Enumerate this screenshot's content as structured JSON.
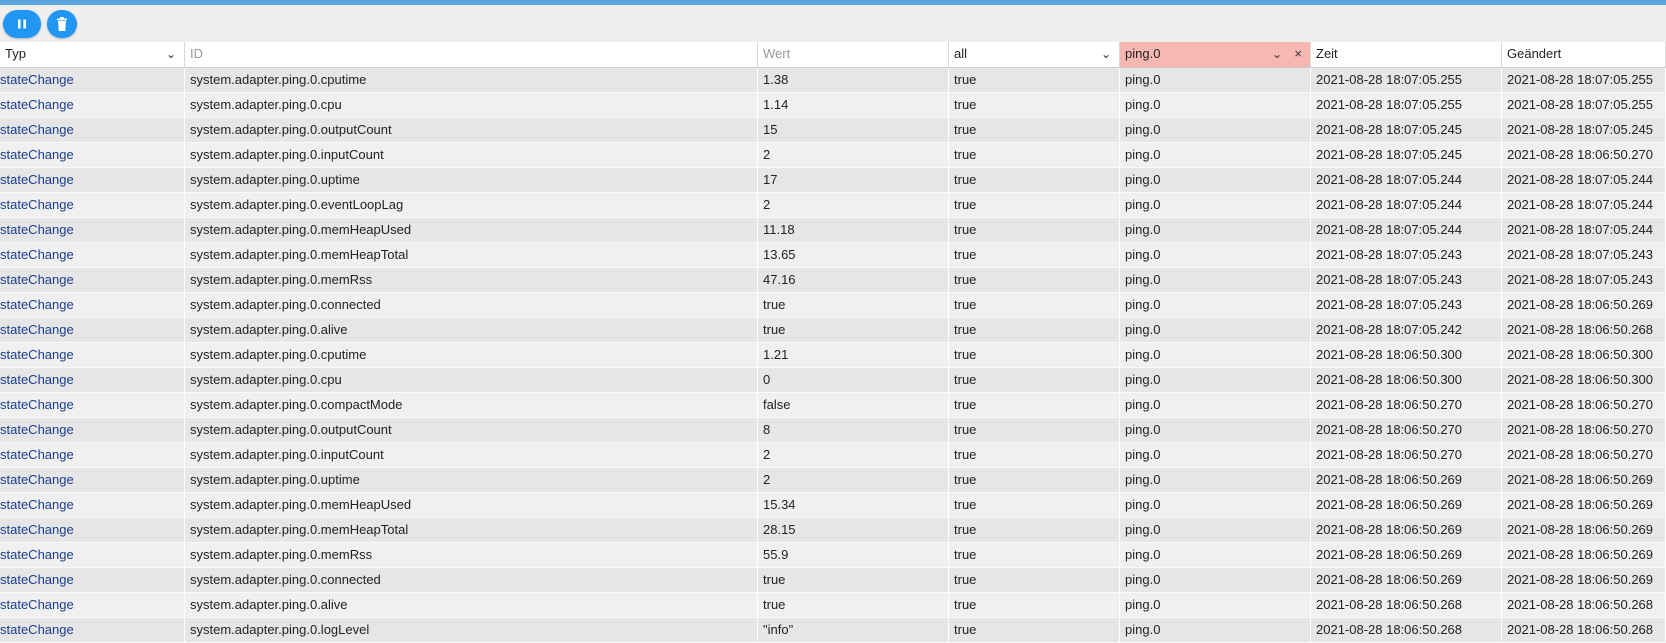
{
  "toolbar": {
    "pause_icon": "pause-icon",
    "delete_icon": "trash-icon",
    "accent": "#2196f3"
  },
  "filters": {
    "type": {
      "value": "Typ"
    },
    "id": {
      "placeholder": "ID"
    },
    "value": {
      "placeholder": "Wert"
    },
    "ack": {
      "value": "all"
    },
    "from": {
      "value": "ping.0",
      "clear": "×"
    },
    "time_label": "Zeit",
    "changed_label": "Geändert"
  },
  "rows": [
    {
      "type": "stateChange",
      "id": "system.adapter.ping.0.cputime",
      "value": "1.38",
      "ack": "true",
      "from": "ping.0",
      "time": "2021-08-28 18:07:05.255",
      "changed": "2021-08-28 18:07:05.255"
    },
    {
      "type": "stateChange",
      "id": "system.adapter.ping.0.cpu",
      "value": "1.14",
      "ack": "true",
      "from": "ping.0",
      "time": "2021-08-28 18:07:05.255",
      "changed": "2021-08-28 18:07:05.255"
    },
    {
      "type": "stateChange",
      "id": "system.adapter.ping.0.outputCount",
      "value": "15",
      "ack": "true",
      "from": "ping.0",
      "time": "2021-08-28 18:07:05.245",
      "changed": "2021-08-28 18:07:05.245"
    },
    {
      "type": "stateChange",
      "id": "system.adapter.ping.0.inputCount",
      "value": "2",
      "ack": "true",
      "from": "ping.0",
      "time": "2021-08-28 18:07:05.245",
      "changed": "2021-08-28 18:06:50.270"
    },
    {
      "type": "stateChange",
      "id": "system.adapter.ping.0.uptime",
      "value": "17",
      "ack": "true",
      "from": "ping.0",
      "time": "2021-08-28 18:07:05.244",
      "changed": "2021-08-28 18:07:05.244"
    },
    {
      "type": "stateChange",
      "id": "system.adapter.ping.0.eventLoopLag",
      "value": "2",
      "ack": "true",
      "from": "ping.0",
      "time": "2021-08-28 18:07:05.244",
      "changed": "2021-08-28 18:07:05.244"
    },
    {
      "type": "stateChange",
      "id": "system.adapter.ping.0.memHeapUsed",
      "value": "11.18",
      "ack": "true",
      "from": "ping.0",
      "time": "2021-08-28 18:07:05.244",
      "changed": "2021-08-28 18:07:05.244"
    },
    {
      "type": "stateChange",
      "id": "system.adapter.ping.0.memHeapTotal",
      "value": "13.65",
      "ack": "true",
      "from": "ping.0",
      "time": "2021-08-28 18:07:05.243",
      "changed": "2021-08-28 18:07:05.243"
    },
    {
      "type": "stateChange",
      "id": "system.adapter.ping.0.memRss",
      "value": "47.16",
      "ack": "true",
      "from": "ping.0",
      "time": "2021-08-28 18:07:05.243",
      "changed": "2021-08-28 18:07:05.243"
    },
    {
      "type": "stateChange",
      "id": "system.adapter.ping.0.connected",
      "value": "true",
      "ack": "true",
      "from": "ping.0",
      "time": "2021-08-28 18:07:05.243",
      "changed": "2021-08-28 18:06:50.269"
    },
    {
      "type": "stateChange",
      "id": "system.adapter.ping.0.alive",
      "value": "true",
      "ack": "true",
      "from": "ping.0",
      "time": "2021-08-28 18:07:05.242",
      "changed": "2021-08-28 18:06:50.268"
    },
    {
      "type": "stateChange",
      "id": "system.adapter.ping.0.cputime",
      "value": "1.21",
      "ack": "true",
      "from": "ping.0",
      "time": "2021-08-28 18:06:50.300",
      "changed": "2021-08-28 18:06:50.300"
    },
    {
      "type": "stateChange",
      "id": "system.adapter.ping.0.cpu",
      "value": "0",
      "ack": "true",
      "from": "ping.0",
      "time": "2021-08-28 18:06:50.300",
      "changed": "2021-08-28 18:06:50.300"
    },
    {
      "type": "stateChange",
      "id": "system.adapter.ping.0.compactMode",
      "value": "false",
      "ack": "true",
      "from": "ping.0",
      "time": "2021-08-28 18:06:50.270",
      "changed": "2021-08-28 18:06:50.270"
    },
    {
      "type": "stateChange",
      "id": "system.adapter.ping.0.outputCount",
      "value": "8",
      "ack": "true",
      "from": "ping.0",
      "time": "2021-08-28 18:06:50.270",
      "changed": "2021-08-28 18:06:50.270"
    },
    {
      "type": "stateChange",
      "id": "system.adapter.ping.0.inputCount",
      "value": "2",
      "ack": "true",
      "from": "ping.0",
      "time": "2021-08-28 18:06:50.270",
      "changed": "2021-08-28 18:06:50.270"
    },
    {
      "type": "stateChange",
      "id": "system.adapter.ping.0.uptime",
      "value": "2",
      "ack": "true",
      "from": "ping.0",
      "time": "2021-08-28 18:06:50.269",
      "changed": "2021-08-28 18:06:50.269"
    },
    {
      "type": "stateChange",
      "id": "system.adapter.ping.0.memHeapUsed",
      "value": "15.34",
      "ack": "true",
      "from": "ping.0",
      "time": "2021-08-28 18:06:50.269",
      "changed": "2021-08-28 18:06:50.269"
    },
    {
      "type": "stateChange",
      "id": "system.adapter.ping.0.memHeapTotal",
      "value": "28.15",
      "ack": "true",
      "from": "ping.0",
      "time": "2021-08-28 18:06:50.269",
      "changed": "2021-08-28 18:06:50.269"
    },
    {
      "type": "stateChange",
      "id": "system.adapter.ping.0.memRss",
      "value": "55.9",
      "ack": "true",
      "from": "ping.0",
      "time": "2021-08-28 18:06:50.269",
      "changed": "2021-08-28 18:06:50.269"
    },
    {
      "type": "stateChange",
      "id": "system.adapter.ping.0.connected",
      "value": "true",
      "ack": "true",
      "from": "ping.0",
      "time": "2021-08-28 18:06:50.269",
      "changed": "2021-08-28 18:06:50.269"
    },
    {
      "type": "stateChange",
      "id": "system.adapter.ping.0.alive",
      "value": "true",
      "ack": "true",
      "from": "ping.0",
      "time": "2021-08-28 18:06:50.268",
      "changed": "2021-08-28 18:06:50.268"
    },
    {
      "type": "stateChange",
      "id": "system.adapter.ping.0.logLevel",
      "value": "\"info\"",
      "ack": "true",
      "from": "ping.0",
      "time": "2021-08-28 18:06:50.268",
      "changed": "2021-08-28 18:06:50.268"
    }
  ]
}
